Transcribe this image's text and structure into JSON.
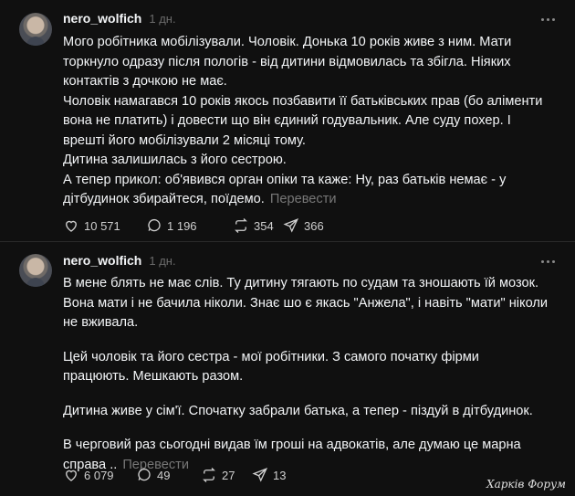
{
  "posts": [
    {
      "username": "nero_wolfich",
      "time": "1 дн.",
      "lines": [
        "Мого робітника мобілізували. Чоловік. Донька 10 років живе з ним. Мати",
        "торкнуло одразу після пологів - від дитини відмовилась та збігла. Ніяких",
        "контактів з дочкою не має.",
        "Чоловік намагався 10 років якось позбавити її батьківських прав (бо аліменти",
        "вона не платить) і довести що він єдиний годувальник. Але суду похер. І",
        "врешті його мобілізували 2 місяці тому.",
        "Дитина залишилась з його сестрою.",
        "А тепер прикол: об'явився орган опіки та каже: Ну, раз батьків немає - у",
        "дітбудинок збирайтеся, поїдемо."
      ],
      "translate": "Перевести",
      "likes": "10 571",
      "comments": "1 196",
      "reposts": "354",
      "shares": "366"
    },
    {
      "username": "nero_wolfich",
      "time": "1 дн.",
      "paragraphs": [
        [
          "В мене блять не має слів. Ту дитину тягають по судам та зношають їй мозок.",
          "Вона мати і не бачила ніколи. Знає шо є якась \"Анжела\", і навіть \"мати\" ніколи",
          "не вживала."
        ],
        [
          "Цей чоловік та його сестра - мої робітники. З самого початку фірми",
          "працюють. Мешкають разом."
        ],
        [
          "Дитина живе у сім'ї. Спочатку забрали батька, а тепер - піздуй в дітбудинок."
        ],
        [
          "В черговий раз сьогодні видав їм гроші на адвокатів, але думаю це марна",
          "справа .."
        ]
      ],
      "translate": "Перевести",
      "likes": "6 079",
      "comments": "49",
      "reposts": "27",
      "shares": "13"
    }
  ],
  "icons": [
    "avatar",
    "more-icon",
    "heart-icon",
    "comment-icon",
    "repost-icon",
    "share-icon"
  ],
  "watermark": "Харків Форум"
}
